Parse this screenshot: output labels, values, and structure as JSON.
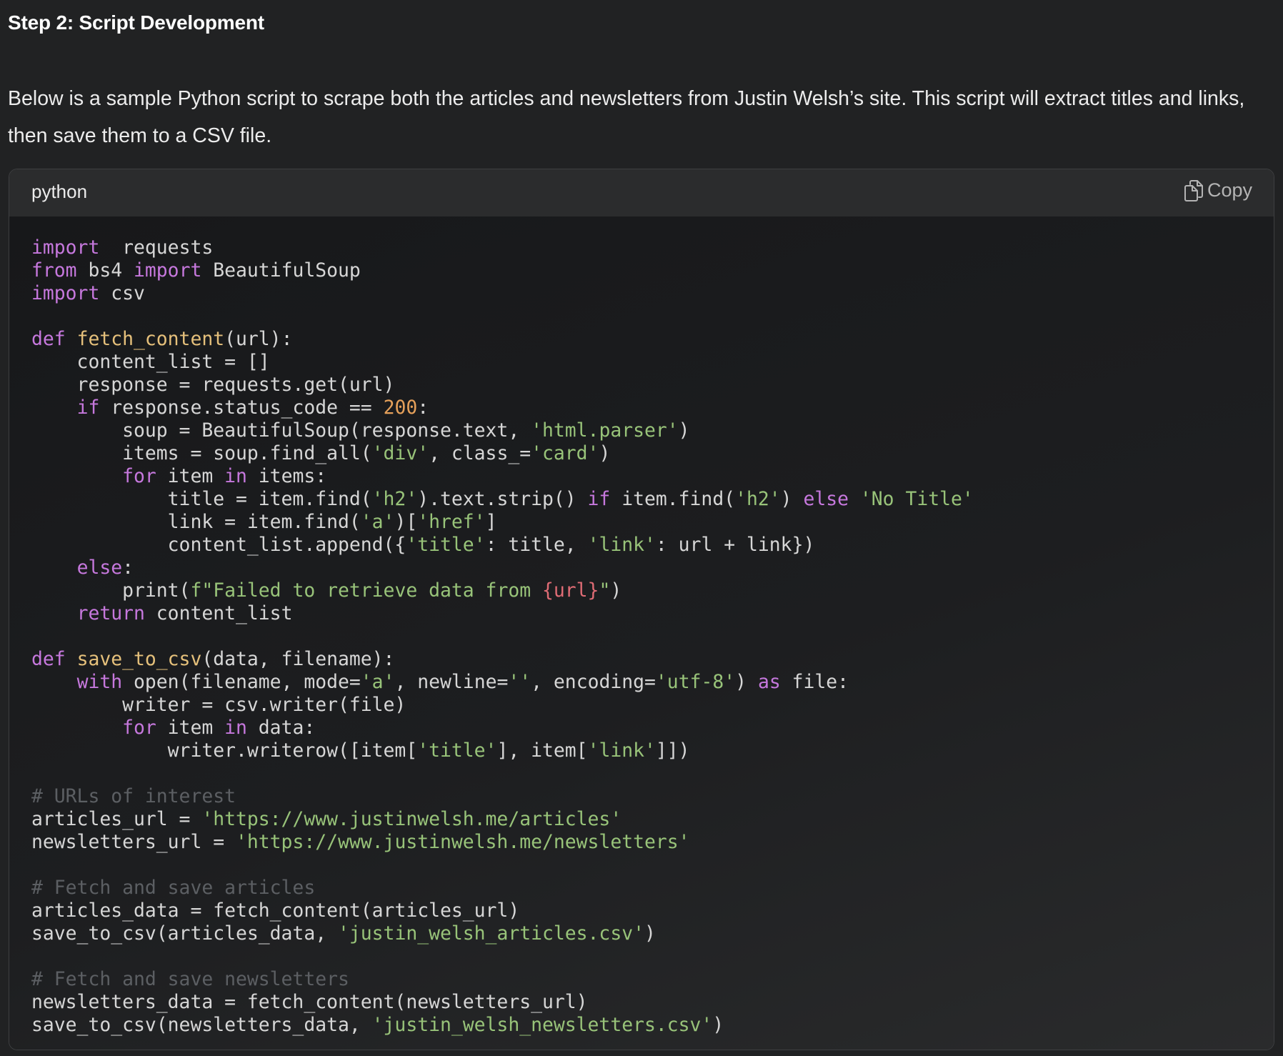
{
  "heading": "Step 2: Script Development",
  "intro": "Below is a sample Python script to scrape both the articles and newsletters from Justin Welsh’s site. This script will extract titles and links, then save them to a CSV file.",
  "code_block": {
    "language": "python",
    "copy_label": "Copy",
    "lines": [
      [
        [
          "kw",
          "import"
        ],
        [
          "",
          "  requests"
        ]
      ],
      [
        [
          "kw",
          "from"
        ],
        [
          "",
          " bs4 "
        ],
        [
          "kw",
          "import"
        ],
        [
          "",
          " BeautifulSoup"
        ]
      ],
      [
        [
          "kw",
          "import"
        ],
        [
          "",
          " csv"
        ]
      ],
      [],
      [
        [
          "kw",
          "def"
        ],
        [
          "",
          " "
        ],
        [
          "fn",
          "fetch_content"
        ],
        [
          "",
          "(url):"
        ]
      ],
      [
        [
          "",
          "    content_list = []"
        ]
      ],
      [
        [
          "",
          "    response = requests.get(url)"
        ]
      ],
      [
        [
          "",
          "    "
        ],
        [
          "kw",
          "if"
        ],
        [
          "",
          " response.status_code == "
        ],
        [
          "num",
          "200"
        ],
        [
          "",
          ":"
        ]
      ],
      [
        [
          "",
          "        soup = BeautifulSoup(response.text, "
        ],
        [
          "str",
          "'html.parser'"
        ],
        [
          "",
          ")"
        ]
      ],
      [
        [
          "",
          "        items = soup.find_all("
        ],
        [
          "str",
          "'div'"
        ],
        [
          "",
          ", class_="
        ],
        [
          "str",
          "'card'"
        ],
        [
          "",
          ")"
        ]
      ],
      [
        [
          "",
          "        "
        ],
        [
          "kw",
          "for"
        ],
        [
          "",
          " item "
        ],
        [
          "kw",
          "in"
        ],
        [
          "",
          " items:"
        ]
      ],
      [
        [
          "",
          "            title = item.find("
        ],
        [
          "str",
          "'h2'"
        ],
        [
          "",
          ").text.strip() "
        ],
        [
          "kw",
          "if"
        ],
        [
          "",
          " item.find("
        ],
        [
          "str",
          "'h2'"
        ],
        [
          "",
          ") "
        ],
        [
          "kw",
          "else"
        ],
        [
          "",
          " "
        ],
        [
          "str",
          "'No Title'"
        ]
      ],
      [
        [
          "",
          "            link = item.find("
        ],
        [
          "str",
          "'a'"
        ],
        [
          "",
          ")["
        ],
        [
          "str",
          "'href'"
        ],
        [
          "",
          "]"
        ]
      ],
      [
        [
          "",
          "            content_list.append({"
        ],
        [
          "str",
          "'title'"
        ],
        [
          "",
          ": title, "
        ],
        [
          "str",
          "'link'"
        ],
        [
          "",
          ": url + link})"
        ]
      ],
      [
        [
          "",
          "    "
        ],
        [
          "kw",
          "else"
        ],
        [
          "",
          ":"
        ]
      ],
      [
        [
          "",
          "        print("
        ],
        [
          "str",
          "f\"Failed to retrieve data from "
        ],
        [
          "interp",
          "{url}"
        ],
        [
          "str",
          "\""
        ],
        [
          "",
          ")"
        ]
      ],
      [
        [
          "",
          "    "
        ],
        [
          "kw",
          "return"
        ],
        [
          "",
          " content_list"
        ]
      ],
      [],
      [
        [
          "kw",
          "def"
        ],
        [
          "",
          " "
        ],
        [
          "fn",
          "save_to_csv"
        ],
        [
          "",
          "(data, filename):"
        ]
      ],
      [
        [
          "",
          "    "
        ],
        [
          "kw",
          "with"
        ],
        [
          "",
          " open(filename, mode="
        ],
        [
          "str",
          "'a'"
        ],
        [
          "",
          ", newline="
        ],
        [
          "str",
          "''"
        ],
        [
          "",
          ", encoding="
        ],
        [
          "str",
          "'utf-8'"
        ],
        [
          "",
          ") "
        ],
        [
          "kw",
          "as"
        ],
        [
          "",
          " file:"
        ]
      ],
      [
        [
          "",
          "        writer = csv.writer(file)"
        ]
      ],
      [
        [
          "",
          "        "
        ],
        [
          "kw",
          "for"
        ],
        [
          "",
          " item "
        ],
        [
          "kw",
          "in"
        ],
        [
          "",
          " data:"
        ]
      ],
      [
        [
          "",
          "            writer.writerow([item["
        ],
        [
          "str",
          "'title'"
        ],
        [
          "",
          "], item["
        ],
        [
          "str",
          "'link'"
        ],
        [
          "",
          "]])"
        ]
      ],
      [],
      [
        [
          "cm",
          "# URLs of interest"
        ]
      ],
      [
        [
          "",
          "articles_url = "
        ],
        [
          "str",
          "'https://www.justinwelsh.me/articles'"
        ]
      ],
      [
        [
          "",
          "newsletters_url = "
        ],
        [
          "str",
          "'https://www.justinwelsh.me/newsletters'"
        ]
      ],
      [],
      [
        [
          "cm",
          "# Fetch and save articles"
        ]
      ],
      [
        [
          "",
          "articles_data = fetch_content(articles_url)"
        ]
      ],
      [
        [
          "",
          "save_to_csv(articles_data, "
        ],
        [
          "str",
          "'justin_welsh_articles.csv'"
        ],
        [
          "",
          ")"
        ]
      ],
      [],
      [
        [
          "cm",
          "# Fetch and save newsletters"
        ]
      ],
      [
        [
          "",
          "newsletters_data = fetch_content(newsletters_url)"
        ]
      ],
      [
        [
          "",
          "save_to_csv(newsletters_data, "
        ],
        [
          "str",
          "'justin_welsh_newsletters.csv'"
        ],
        [
          "",
          ")"
        ]
      ]
    ]
  }
}
